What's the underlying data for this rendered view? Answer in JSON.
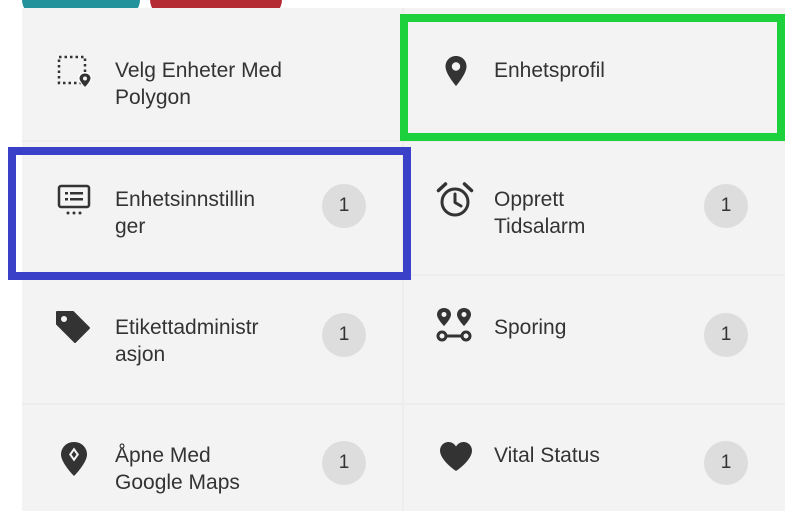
{
  "menu": {
    "items": [
      {
        "label": "Velg Enheter Med\nPolygon",
        "icon": "select-polygon-icon",
        "count": null
      },
      {
        "label": "Enhetsprofil",
        "icon": "location-pin-icon",
        "count": null
      },
      {
        "label": "Enhetsinnstillin\nger",
        "icon": "device-settings-icon",
        "count": "1"
      },
      {
        "label": "Opprett\nTidsalarm",
        "icon": "alarm-clock-icon",
        "count": "1"
      },
      {
        "label": "Etikettadministr\nasjon",
        "icon": "tag-icon",
        "count": "1"
      },
      {
        "label": "Sporing",
        "icon": "tracking-route-icon",
        "count": "1"
      },
      {
        "label": "Åpne Med\nGoogle Maps",
        "icon": "map-marker-icon",
        "count": "1"
      },
      {
        "label": "Vital Status",
        "icon": "heart-icon",
        "count": "1"
      }
    ]
  },
  "colors": {
    "highlight_green": "#1cd13c",
    "highlight_blue": "#3a40c8",
    "tab_teal": "#24929a",
    "tab_red": "#b42b34",
    "badge_bg": "#dddddd"
  }
}
